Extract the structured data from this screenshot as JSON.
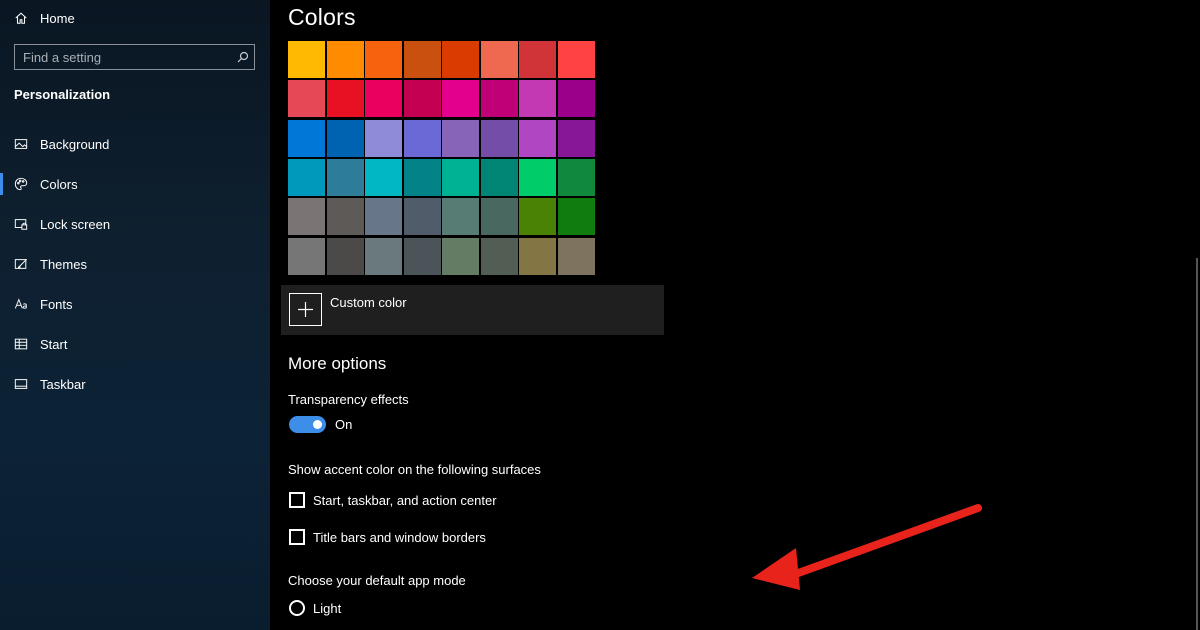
{
  "sidebar": {
    "home_label": "Home",
    "search_placeholder": "Find a setting",
    "section_title": "Personalization",
    "items": [
      {
        "label": "Background",
        "icon": "picture-icon"
      },
      {
        "label": "Colors",
        "icon": "palette-icon"
      },
      {
        "label": "Lock screen",
        "icon": "lock-screen-icon"
      },
      {
        "label": "Themes",
        "icon": "brush-icon"
      },
      {
        "label": "Fonts",
        "icon": "font-icon"
      },
      {
        "label": "Start",
        "icon": "start-icon"
      },
      {
        "label": "Taskbar",
        "icon": "taskbar-icon"
      }
    ],
    "active_item": "Colors",
    "accent_color": "#3d8ee8"
  },
  "main": {
    "title": "Colors",
    "palette": [
      [
        "#ffb900",
        "#ff8c00",
        "#f7630c",
        "#ca5010",
        "#da3b01",
        "#ef6950",
        "#d13438",
        "#ff4343"
      ],
      [
        "#e74856",
        "#e81123",
        "#ea005e",
        "#c30052",
        "#e3008c",
        "#bf0077",
        "#c239b3",
        "#9a0089"
      ],
      [
        "#0078d7",
        "#0063b1",
        "#8e8cd8",
        "#6b69d6",
        "#8764b8",
        "#744da9",
        "#b146c2",
        "#881798"
      ],
      [
        "#0099bc",
        "#2d7d9a",
        "#00b7c3",
        "#038387",
        "#00b294",
        "#018574",
        "#00cc6a",
        "#10893e"
      ],
      [
        "#7a7574",
        "#5d5a58",
        "#68768a",
        "#515c6b",
        "#567c73",
        "#486860",
        "#498205",
        "#107c10"
      ],
      [
        "#767676",
        "#4c4a48",
        "#69797e",
        "#4a5459",
        "#647c64",
        "#525e54",
        "#847545",
        "#7e735f"
      ]
    ],
    "custom_color_label": "Custom color",
    "more_options_heading": "More options",
    "transparency": {
      "label": "Transparency effects",
      "state": "On"
    },
    "accent_surfaces_label": "Show accent color on the following surfaces",
    "checkboxes": [
      {
        "label": "Start, taskbar, and action center",
        "checked": false
      },
      {
        "label": "Title bars and window borders",
        "checked": false
      }
    ],
    "app_mode_label": "Choose your default app mode",
    "app_mode_options": [
      {
        "label": "Light",
        "selected": false
      }
    ],
    "annotation_arrow_color": "#e8231b"
  }
}
